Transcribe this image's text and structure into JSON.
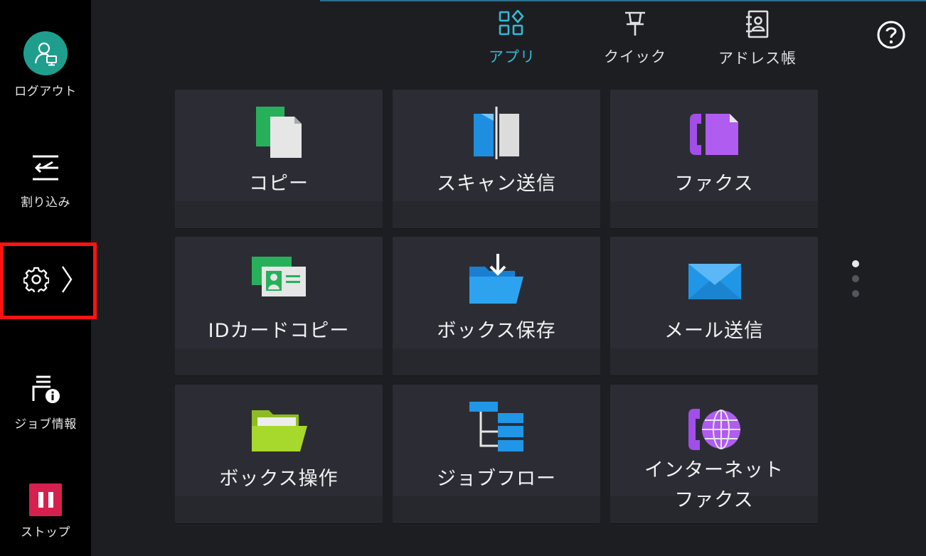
{
  "sidebar": {
    "logout_label": "ログアウト",
    "interrupt_label": "割り込み",
    "jobinfo_label": "ジョブ情報",
    "stop_label": "ストップ"
  },
  "tabs": [
    {
      "label": "アプリ",
      "icon": "apps-grid-icon",
      "active": true
    },
    {
      "label": "クイック",
      "icon": "pin-icon",
      "active": false
    },
    {
      "label": "アドレス帳",
      "icon": "address-book-icon",
      "active": false
    }
  ],
  "apps": [
    {
      "label": "コピー",
      "icon": "copy-icon"
    },
    {
      "label": "スキャン送信",
      "icon": "scan-send-icon"
    },
    {
      "label": "ファクス",
      "icon": "fax-icon"
    },
    {
      "label": "IDカードコピー",
      "icon": "id-card-copy-icon"
    },
    {
      "label": "ボックス保存",
      "icon": "box-save-icon"
    },
    {
      "label": "メール送信",
      "icon": "mail-send-icon"
    },
    {
      "label": "ボックス操作",
      "icon": "box-operation-icon"
    },
    {
      "label": "ジョブフロー",
      "icon": "job-flow-icon"
    },
    {
      "label": "インターネット",
      "label2": "ファクス",
      "icon": "internet-fax-icon"
    }
  ],
  "pager": {
    "pages": 3,
    "current": 1
  },
  "colors": {
    "accent": "#35b9d6",
    "highlight_border": "#ff1212",
    "stop": "#d6214f",
    "avatar": "#1f9e8e"
  }
}
